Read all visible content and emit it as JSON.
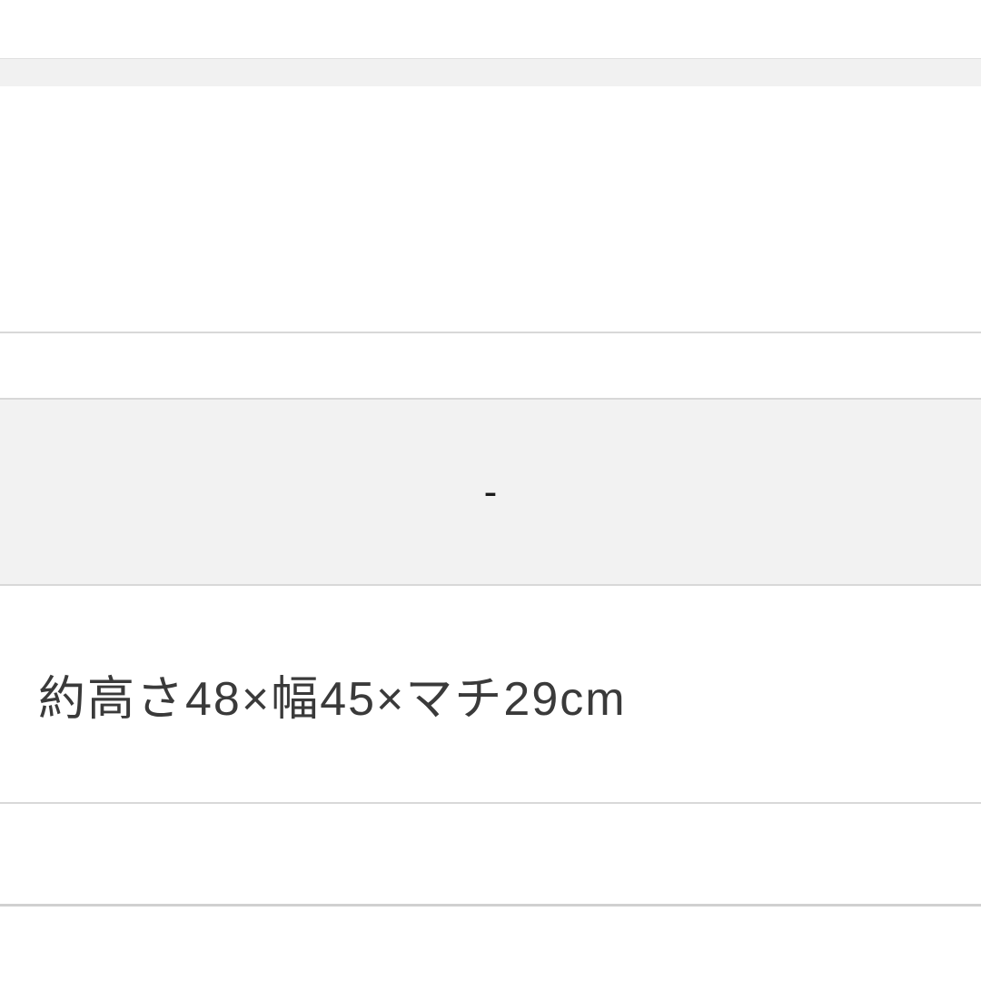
{
  "rows": {
    "dash_value": "-",
    "dimensions_text": "約高さ48×幅45×マチ29cm"
  }
}
